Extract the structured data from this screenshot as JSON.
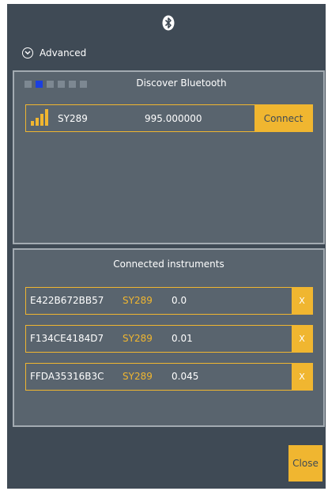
{
  "header": {
    "icon": "bluetooth-icon",
    "advanced_label": "Advanced"
  },
  "discover": {
    "title": "Discover Bluetooth",
    "progress_step_active": 2,
    "progress_steps": 6,
    "devices": [
      {
        "name": "SY289",
        "rssi": "995.000000",
        "connect_label": "Connect"
      }
    ]
  },
  "connected": {
    "title": "Connected instruments",
    "instruments": [
      {
        "id": "E422B672BB57",
        "model": "SY289",
        "value": "0.0",
        "remove_label": "X"
      },
      {
        "id": "F134CE4184D7",
        "model": "SY289",
        "value": "0.01",
        "remove_label": "X"
      },
      {
        "id": "FFDA35316B3C",
        "model": "SY289",
        "value": "0.045",
        "remove_label": "X"
      }
    ]
  },
  "footer": {
    "close_label": "Close"
  },
  "colors": {
    "background": "#3f4a55",
    "panel": "#59646e",
    "accent": "#f0b630",
    "progress_active": "#1b3fe0"
  }
}
